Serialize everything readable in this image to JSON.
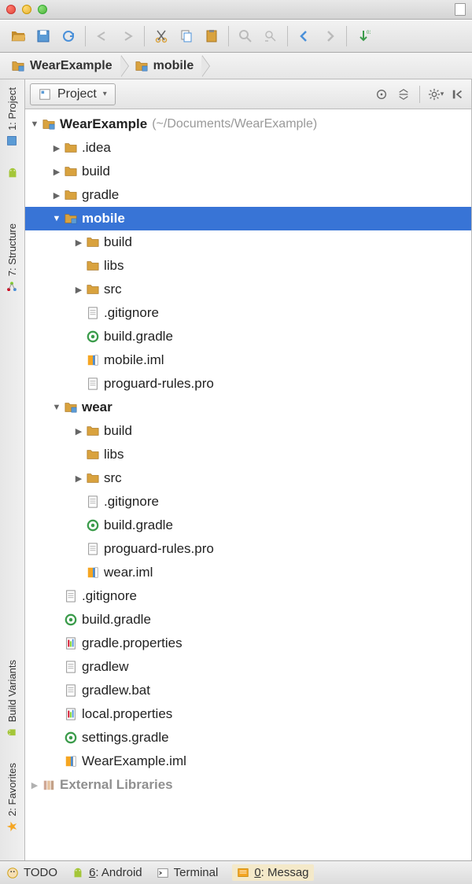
{
  "breadcrumb": [
    {
      "label": "WearExample",
      "icon": "module"
    },
    {
      "label": "mobile",
      "icon": "module"
    }
  ],
  "panel": {
    "view_label": "Project"
  },
  "sidebar_tabs": [
    {
      "label": "1: Project",
      "icon": "project"
    },
    {
      "label": "7: Structure",
      "icon": "structure"
    },
    {
      "label": "Build Variants",
      "icon": "android"
    },
    {
      "label": "2: Favorites",
      "icon": "star"
    }
  ],
  "tree": [
    {
      "d": 0,
      "arrow": "down",
      "icon": "module",
      "label": "WearExample",
      "path": "(~/Documents/WearExample)",
      "bold": true
    },
    {
      "d": 1,
      "arrow": "right",
      "icon": "folder",
      "label": ".idea"
    },
    {
      "d": 1,
      "arrow": "right",
      "icon": "folder",
      "label": "build"
    },
    {
      "d": 1,
      "arrow": "right",
      "icon": "folder",
      "label": "gradle"
    },
    {
      "d": 1,
      "arrow": "down",
      "icon": "module",
      "label": "mobile",
      "bold": true,
      "selected": true
    },
    {
      "d": 2,
      "arrow": "right",
      "icon": "folder",
      "label": "build"
    },
    {
      "d": 2,
      "arrow": "",
      "icon": "folder",
      "label": "libs"
    },
    {
      "d": 2,
      "arrow": "right",
      "icon": "folder",
      "label": "src"
    },
    {
      "d": 2,
      "arrow": "",
      "icon": "file",
      "label": ".gitignore"
    },
    {
      "d": 2,
      "arrow": "",
      "icon": "gradle",
      "label": "build.gradle"
    },
    {
      "d": 2,
      "arrow": "",
      "icon": "iml",
      "label": "mobile.iml"
    },
    {
      "d": 2,
      "arrow": "",
      "icon": "file",
      "label": "proguard-rules.pro"
    },
    {
      "d": 1,
      "arrow": "down",
      "icon": "module",
      "label": "wear",
      "bold": true
    },
    {
      "d": 2,
      "arrow": "right",
      "icon": "folder",
      "label": "build"
    },
    {
      "d": 2,
      "arrow": "",
      "icon": "folder",
      "label": "libs"
    },
    {
      "d": 2,
      "arrow": "right",
      "icon": "folder",
      "label": "src"
    },
    {
      "d": 2,
      "arrow": "",
      "icon": "file",
      "label": ".gitignore"
    },
    {
      "d": 2,
      "arrow": "",
      "icon": "gradle",
      "label": "build.gradle"
    },
    {
      "d": 2,
      "arrow": "",
      "icon": "file",
      "label": "proguard-rules.pro"
    },
    {
      "d": 2,
      "arrow": "",
      "icon": "iml",
      "label": "wear.iml"
    },
    {
      "d": 1,
      "arrow": "",
      "icon": "file",
      "label": ".gitignore"
    },
    {
      "d": 1,
      "arrow": "",
      "icon": "gradle",
      "label": "build.gradle"
    },
    {
      "d": 1,
      "arrow": "",
      "icon": "props",
      "label": "gradle.properties"
    },
    {
      "d": 1,
      "arrow": "",
      "icon": "file",
      "label": "gradlew"
    },
    {
      "d": 1,
      "arrow": "",
      "icon": "file",
      "label": "gradlew.bat"
    },
    {
      "d": 1,
      "arrow": "",
      "icon": "props",
      "label": "local.properties"
    },
    {
      "d": 1,
      "arrow": "",
      "icon": "gradle",
      "label": "settings.gradle"
    },
    {
      "d": 1,
      "arrow": "",
      "icon": "iml",
      "label": "WearExample.iml"
    },
    {
      "d": 0,
      "arrow": "right",
      "icon": "lib",
      "label": "External Libraries",
      "bold": true,
      "cut": true
    }
  ],
  "bottom_tabs": [
    {
      "label": "TODO",
      "icon": "todo"
    },
    {
      "label": "6: Android",
      "icon": "android",
      "u": "6"
    },
    {
      "label": "Terminal",
      "icon": "terminal"
    },
    {
      "label": "0: Messag",
      "icon": "messages",
      "u": "0",
      "active": true
    }
  ]
}
